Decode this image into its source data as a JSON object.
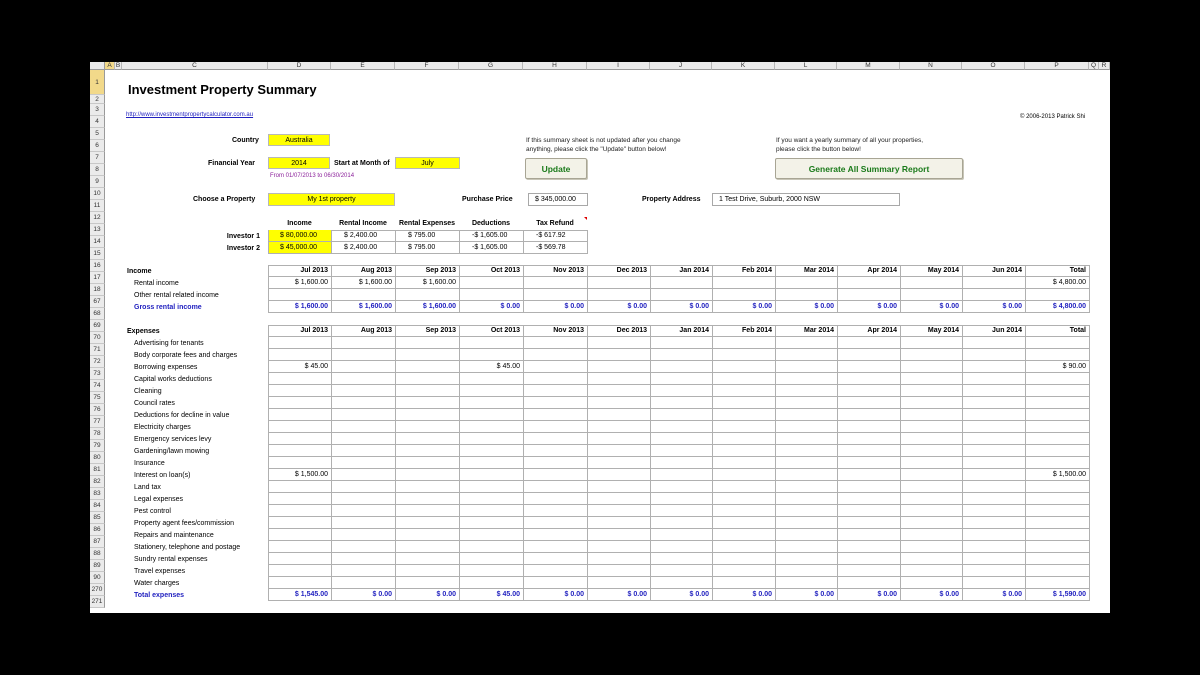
{
  "sheet": {
    "columns": [
      "A",
      "B",
      "C",
      "D",
      "E",
      "F",
      "G",
      "H",
      "I",
      "J",
      "K",
      "L",
      "M",
      "N",
      "O",
      "P",
      "Q",
      "R"
    ],
    "rows": [
      "1",
      "2",
      "3",
      "4",
      "5",
      "6",
      "7",
      "8",
      "9",
      "10",
      "11",
      "12",
      "13",
      "14",
      "15",
      "16",
      "17",
      "18",
      "67",
      "68",
      "69",
      "70",
      "71",
      "72",
      "73",
      "74",
      "75",
      "76",
      "77",
      "78",
      "79",
      "80",
      "81",
      "82",
      "83",
      "84",
      "85",
      "86",
      "87",
      "88",
      "89",
      "90",
      "270",
      "271"
    ]
  },
  "header": {
    "title": "Investment Property Summary",
    "link": "http://www.investmentpropertycalculator.com.au",
    "copyright": "© 2006-2013 Patrick Shi"
  },
  "settings": {
    "country_label": "Country",
    "country_value": "Australia",
    "fy_label": "Financial Year",
    "fy_value": "2014",
    "start_month_label": "Start at Month of",
    "start_month_value": "July",
    "period_note": "From 01/07/2013 to 06/30/2014",
    "property_label": "Choose a Property",
    "property_value": "My 1st property",
    "price_label": "Purchase Price",
    "price_value": "$ 345,000.00",
    "address_label": "Property Address",
    "address_value": "1 Test Drive, Suburb, 2000 NSW"
  },
  "update_panel": {
    "note_line1": "If this summary sheet is not updated after you change",
    "note_line2": "anything, please click the \"Update\" button below!",
    "button": "Update"
  },
  "report_panel": {
    "note_line1": "If you want a yearly summary of all your properties,",
    "note_line2": "please click the button below!",
    "button": "Generate All Summary Report"
  },
  "investors": {
    "headers": [
      "Income",
      "Rental Income",
      "Rental Expenses",
      "Deductions",
      "Tax Refund"
    ],
    "rows": [
      {
        "name": "Investor 1",
        "values": [
          "$ 80,000.00",
          "$ 2,400.00",
          "$ 795.00",
          "-$ 1,605.00",
          "-$ 617.92"
        ]
      },
      {
        "name": "Investor 2",
        "values": [
          "$ 45,000.00",
          "$ 2,400.00",
          "$ 795.00",
          "-$ 1,605.00",
          "-$ 569.78"
        ]
      }
    ]
  },
  "months": [
    "Jul 2013",
    "Aug 2013",
    "Sep 2013",
    "Oct 2013",
    "Nov 2013",
    "Dec 2013",
    "Jan 2014",
    "Feb 2014",
    "Mar 2014",
    "Apr 2014",
    "May 2014",
    "Jun 2014",
    "Total"
  ],
  "income": {
    "label": "Income",
    "rows": [
      {
        "label": "Rental income",
        "values": [
          "$ 1,600.00",
          "$ 1,600.00",
          "$ 1,600.00",
          "",
          "",
          "",
          "",
          "",
          "",
          "",
          "",
          "",
          "$ 4,800.00"
        ]
      },
      {
        "label": "Other rental related income",
        "values": [
          "",
          "",
          "",
          "",
          "",
          "",
          "",
          "",
          "",
          "",
          "",
          "",
          ""
        ]
      }
    ],
    "total": {
      "label": "Gross rental income",
      "values": [
        "$ 1,600.00",
        "$ 1,600.00",
        "$ 1,600.00",
        "$ 0.00",
        "$ 0.00",
        "$ 0.00",
        "$ 0.00",
        "$ 0.00",
        "$ 0.00",
        "$ 0.00",
        "$ 0.00",
        "$ 0.00",
        "$ 4,800.00"
      ]
    }
  },
  "expenses": {
    "label": "Expenses",
    "rows": [
      {
        "label": "Advertising for tenants",
        "values": []
      },
      {
        "label": "Body corporate fees and charges",
        "values": []
      },
      {
        "label": "Borrowing expenses",
        "values": [
          "$ 45.00",
          "",
          "",
          "$ 45.00",
          "",
          "",
          "",
          "",
          "",
          "",
          "",
          "",
          "$ 90.00"
        ]
      },
      {
        "label": "Capital works deductions",
        "values": []
      },
      {
        "label": "Cleaning",
        "values": []
      },
      {
        "label": "Council rates",
        "values": []
      },
      {
        "label": "Deductions for decline in value",
        "values": []
      },
      {
        "label": "Electricity charges",
        "values": []
      },
      {
        "label": "Emergency services levy",
        "values": []
      },
      {
        "label": "Gardening/lawn mowing",
        "values": []
      },
      {
        "label": "Insurance",
        "values": []
      },
      {
        "label": "Interest on loan(s)",
        "values": [
          "$ 1,500.00",
          "",
          "",
          "",
          "",
          "",
          "",
          "",
          "",
          "",
          "",
          "",
          "$ 1,500.00"
        ]
      },
      {
        "label": "Land tax",
        "values": []
      },
      {
        "label": "Legal expenses",
        "values": []
      },
      {
        "label": "Pest control",
        "values": []
      },
      {
        "label": "Property agent fees/commission",
        "values": []
      },
      {
        "label": "Repairs and maintenance",
        "values": []
      },
      {
        "label": "Stationery, telephone and postage",
        "values": []
      },
      {
        "label": "Sundry rental expenses",
        "values": []
      },
      {
        "label": "Travel expenses",
        "values": []
      },
      {
        "label": "Water charges",
        "values": []
      }
    ],
    "total": {
      "label": "Total expenses",
      "values": [
        "$ 1,545.00",
        "$ 0.00",
        "$ 0.00",
        "$ 45.00",
        "$ 0.00",
        "$ 0.00",
        "$ 0.00",
        "$ 0.00",
        "$ 0.00",
        "$ 0.00",
        "$ 0.00",
        "$ 0.00",
        "$ 1,590.00"
      ]
    }
  },
  "colors": {
    "input_fill": "#ffff00",
    "total_text": "#1f1fbf",
    "button_text": "#1a7a1a",
    "selected_header": "#f2d98a"
  }
}
